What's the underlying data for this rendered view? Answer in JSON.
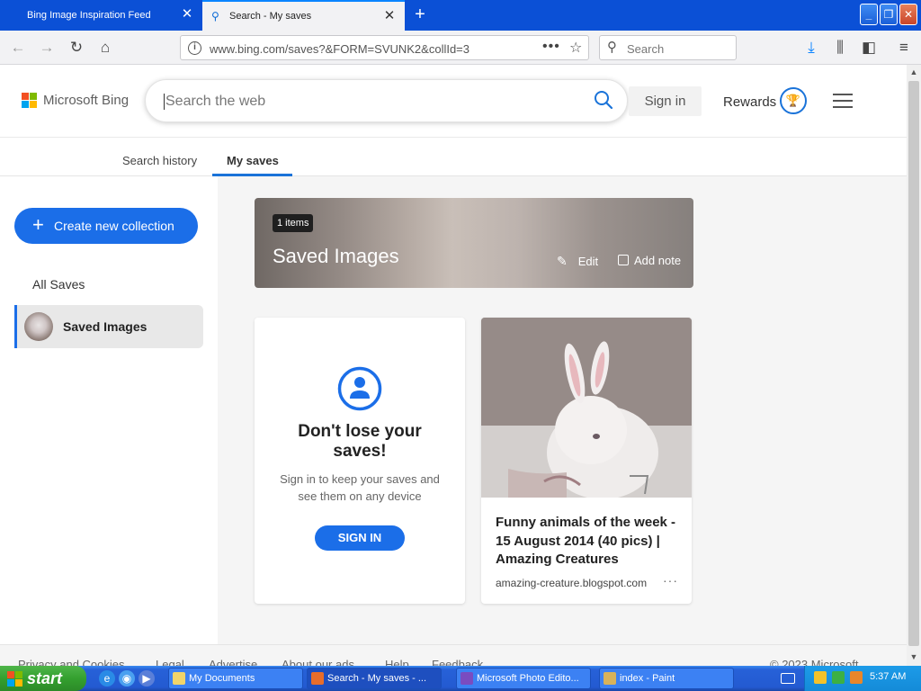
{
  "browser": {
    "tabs": [
      {
        "title": "Bing Image Inspiration Feed"
      },
      {
        "title": "Search - My saves"
      }
    ],
    "url": "www.bing.com/saves?&FORM=SVUNK2&collId=3",
    "search_placeholder": "Search"
  },
  "bing": {
    "logo_text": "Microsoft Bing",
    "search_placeholder": "Search the web",
    "sign_in": "Sign in",
    "rewards": "Rewards",
    "tabs": [
      {
        "label": "Search history"
      },
      {
        "label": "My saves"
      }
    ]
  },
  "sidebar": {
    "create_button": "Create new collection",
    "all_saves": "All Saves",
    "collections": [
      {
        "label": "Saved Images"
      }
    ]
  },
  "collection": {
    "count": "1 items",
    "title": "Saved Images",
    "edit": "Edit",
    "add_note": "Add note"
  },
  "signin_card": {
    "heading": "Don't lose your saves!",
    "description": "Sign in to keep your saves and see them on any device",
    "button": "SIGN IN"
  },
  "saved_item": {
    "title": "Funny animals of the week - 15 August 2014 (40 pics) | Amazing Creatures",
    "source": "amazing-creature.blogspot.com"
  },
  "footer": {
    "links": [
      "Privacy and Cookies",
      "Legal",
      "Advertise",
      "About our ads",
      "Help",
      "Feedback"
    ],
    "copyright": "© 2023 Microsoft"
  },
  "taskbar": {
    "start": "start",
    "windows": [
      {
        "label": "My Documents"
      },
      {
        "label": "Search - My saves - ..."
      },
      {
        "label": "Microsoft Photo Edito..."
      },
      {
        "label": "index - Paint"
      }
    ],
    "clock": "5:37 AM"
  },
  "colors": {
    "accent": "#1b6ee8",
    "titlebar": "#0b50d6",
    "taskbar": "#235ad1",
    "start_green": "#34a02f"
  }
}
